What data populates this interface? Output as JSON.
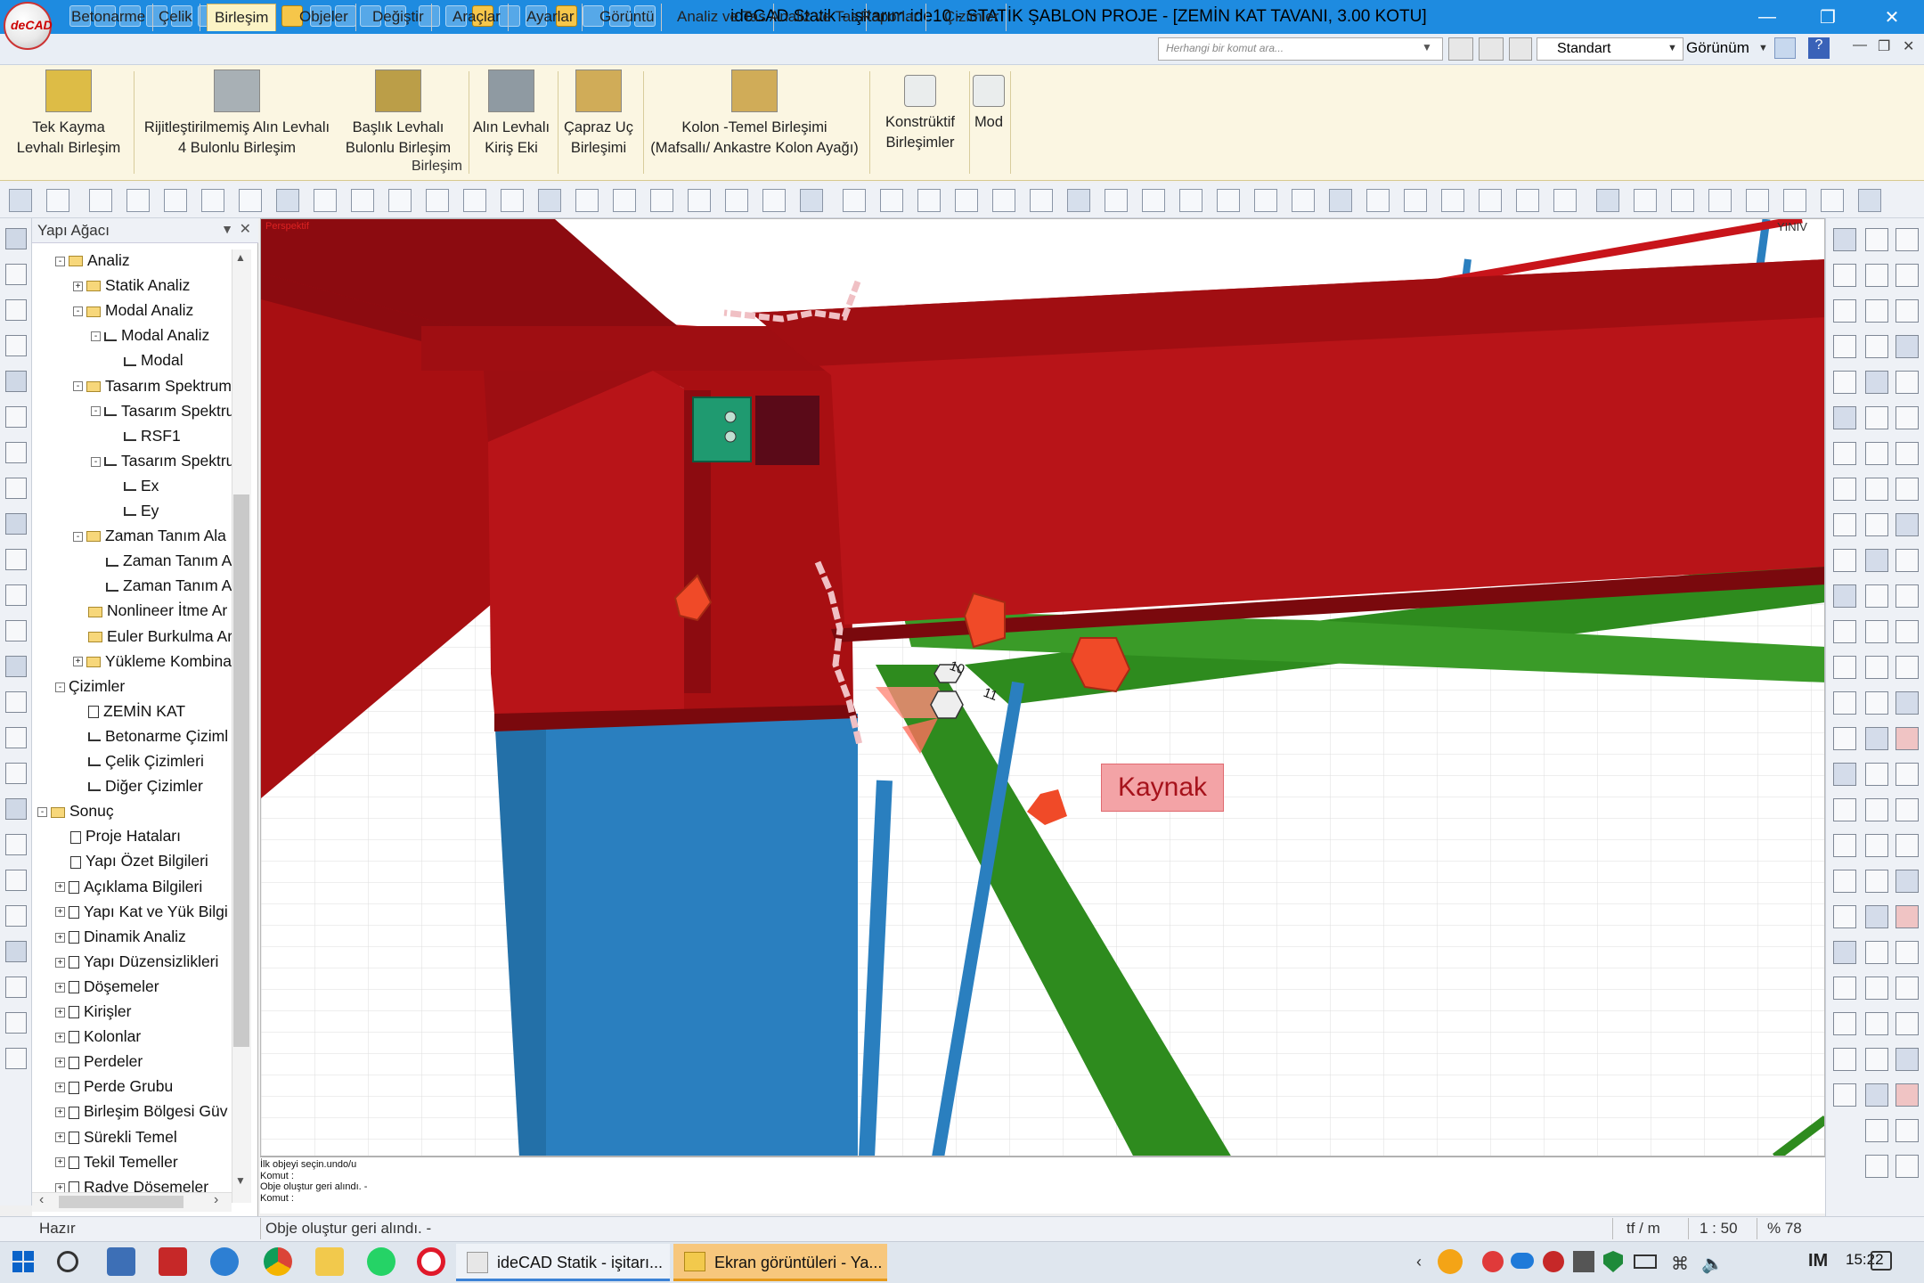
{
  "window": {
    "title": "ideCAD Statik - işitarım.ide10 - STATİK ŞABLON PROJE - [ZEMİN KAT TAVANI,  3.00 KOTU]",
    "logo_text": "deCAD",
    "controls": [
      "minimize-icon",
      "restore-icon",
      "close-icon"
    ]
  },
  "menu": {
    "tabs": [
      "Betonarme",
      "Çelik",
      "Birleşim",
      "Objeler",
      "Değiştir",
      "Araçlar",
      "Ayarlar",
      "Görüntü",
      "Analiz ve Tas",
      "Analiz ve Tas",
      "Raporlar",
      "Çizimler"
    ],
    "active_tab": "Birleşim",
    "search_placeholder": "Herhangi bir komut ara...",
    "style_value": "Standart",
    "view_label": "Görünüm"
  },
  "ribbon": {
    "buttons": [
      {
        "line1": "Tek Kayma",
        "line2": "Levhalı Birleşim"
      },
      {
        "line1": "Rijitleştirilmemiş Alın Levhalı",
        "line2": "4 Bulonlu Birleşim"
      },
      {
        "line1": "Başlık Levhalı",
        "line2": "Bulonlu Birleşim"
      },
      {
        "line1": "Alın Levhalı",
        "line2": "Kiriş Eki"
      },
      {
        "line1": "Çapraz Uç",
        "line2": "Birleşimi"
      },
      {
        "line1": "Kolon -Temel Birleşimi",
        "line2": "(Mafsallı/ Ankastre Kolon Ayağı)"
      },
      {
        "line1": "Konstrüktif",
        "line2": "Birleşimler"
      },
      {
        "line1": "Mod",
        "line2": ""
      }
    ],
    "group_label": "Birleşim"
  },
  "tree": {
    "header": "Yapı Ağacı",
    "nodes": [
      {
        "label": "Analiz",
        "level": 0,
        "box": "-",
        "icon": "folder"
      },
      {
        "label": "Statik Analiz",
        "level": 1,
        "box": "+",
        "icon": "folder"
      },
      {
        "label": "Modal Analiz",
        "level": 1,
        "box": "-",
        "icon": "folder"
      },
      {
        "label": "Modal Analiz",
        "level": 2,
        "box": "-",
        "icon": "chart"
      },
      {
        "label": "Modal",
        "level": 3,
        "box": "",
        "icon": "chart"
      },
      {
        "label": "Tasarım Spektrum",
        "level": 1,
        "box": "-",
        "icon": "folder"
      },
      {
        "label": "Tasarım Spektru",
        "level": 2,
        "box": "-",
        "icon": "chart"
      },
      {
        "label": "RSF1",
        "level": 3,
        "box": "",
        "icon": "chart"
      },
      {
        "label": "Tasarım Spektru",
        "level": 2,
        "box": "-",
        "icon": "chart"
      },
      {
        "label": "Ex",
        "level": 3,
        "box": "",
        "icon": "chart"
      },
      {
        "label": "Ey",
        "level": 3,
        "box": "",
        "icon": "chart"
      },
      {
        "label": "Zaman Tanım Ala",
        "level": 1,
        "box": "-",
        "icon": "folder"
      },
      {
        "label": "Zaman Tanım A",
        "level": 2,
        "box": "",
        "icon": "chart"
      },
      {
        "label": "Zaman Tanım A",
        "level": 2,
        "box": "",
        "icon": "chart"
      },
      {
        "label": "Nonlineer İtme Ar",
        "level": 1,
        "box": "",
        "icon": "folder"
      },
      {
        "label": "Euler Burkulma Ar",
        "level": 1,
        "box": "",
        "icon": "folder"
      },
      {
        "label": "Yükleme Kombina",
        "level": 1,
        "box": "+",
        "icon": "folder"
      },
      {
        "label": "Çizimler",
        "level": 0,
        "box": "-",
        "icon": "none"
      },
      {
        "label": "ZEMİN KAT",
        "level": 1,
        "box": "",
        "icon": "doc"
      },
      {
        "label": "Betonarme Çiziml",
        "level": 1,
        "box": "",
        "icon": "pen"
      },
      {
        "label": "Çelik Çizimleri",
        "level": 1,
        "box": "",
        "icon": "pen"
      },
      {
        "label": "Diğer Çizimler",
        "level": 1,
        "box": "",
        "icon": "pen"
      },
      {
        "label": "Sonuç",
        "level": -1,
        "box": "-",
        "icon": "folder"
      },
      {
        "label": "Proje Hataları",
        "level": 0,
        "box": "",
        "icon": "doc"
      },
      {
        "label": "Yapı Özet Bilgileri",
        "level": 0,
        "box": "",
        "icon": "doc"
      },
      {
        "label": "Açıklama Bilgileri",
        "level": 0,
        "box": "+",
        "icon": "doc"
      },
      {
        "label": "Yapı Kat ve Yük Bilgi",
        "level": 0,
        "box": "+",
        "icon": "doc"
      },
      {
        "label": "Dinamik Analiz",
        "level": 0,
        "box": "+",
        "icon": "doc"
      },
      {
        "label": "Yapı Düzensizlikleri",
        "level": 0,
        "box": "+",
        "icon": "doc"
      },
      {
        "label": "Döşemeler",
        "level": 0,
        "box": "+",
        "icon": "doc"
      },
      {
        "label": "Kirişler",
        "level": 0,
        "box": "+",
        "icon": "doc"
      },
      {
        "label": "Kolonlar",
        "level": 0,
        "box": "+",
        "icon": "doc"
      },
      {
        "label": "Perdeler",
        "level": 0,
        "box": "+",
        "icon": "doc"
      },
      {
        "label": "Perde Grubu",
        "level": 0,
        "box": "+",
        "icon": "doc"
      },
      {
        "label": "Birleşim Bölgesi Güv",
        "level": 0,
        "box": "+",
        "icon": "doc"
      },
      {
        "label": "Sürekli Temel",
        "level": 0,
        "box": "+",
        "icon": "doc"
      },
      {
        "label": "Tekil Temeller",
        "level": 0,
        "box": "+",
        "icon": "doc"
      },
      {
        "label": "Radye Döşemeler",
        "level": 0,
        "box": "+",
        "icon": "doc"
      }
    ]
  },
  "viewport": {
    "mode_label": "Perspektif",
    "callout": "Kaynak",
    "view_buttons": "YINIV",
    "member_labels": [
      "10",
      "11",
      "81"
    ]
  },
  "command_log": [
    "İlk objeyi seçin.undo/u",
    "Komut :",
    "Obje oluştur geri alındı. -",
    "Komut :"
  ],
  "status": {
    "ready": "Hazır",
    "message": "Obje oluştur geri alındı. -",
    "unit": "tf / m",
    "scale": "1 : 50",
    "zoom": "% 78"
  },
  "taskbar": {
    "tasks": [
      "ideCAD Statik - işitarı...",
      "Ekran görüntüleri - Ya..."
    ],
    "time": "15:22"
  },
  "colors": {
    "titlebar": "#1e8be0",
    "ribbon": "#fbf6e2",
    "beam_red": "#a80f12",
    "column_blue": "#2a7fbf",
    "brace_green": "#2e8b1e",
    "plate_orange": "#f04a28"
  }
}
